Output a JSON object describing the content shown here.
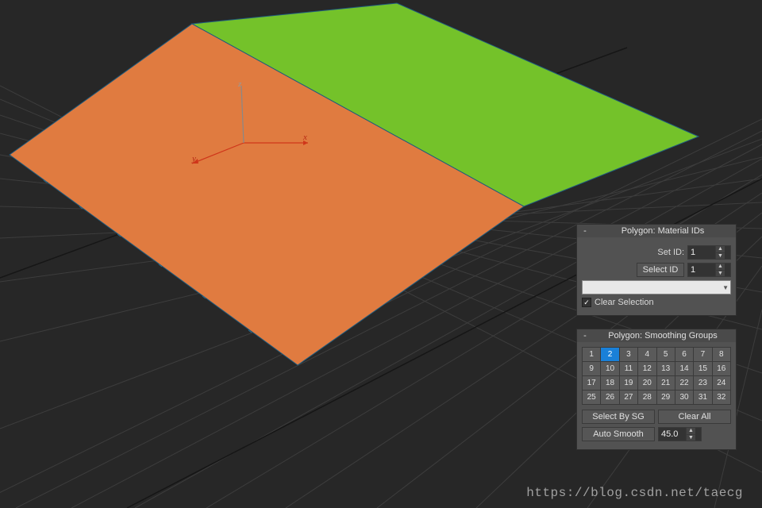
{
  "viewport": {
    "background": "#272727",
    "grid_color": "#3e3e3e",
    "grid_accent": "#555555",
    "plane_color_a": "#e07b40",
    "plane_color_b": "#74c22a",
    "axis_color": "#cf361a",
    "axis_labels": {
      "x": "x",
      "y": "y",
      "z": "z"
    }
  },
  "panel_material": {
    "title": "Polygon: Material IDs",
    "collapse": "-",
    "set_id_label": "Set ID:",
    "set_id_value": "1",
    "select_id_label": "Select ID",
    "select_id_value": "1",
    "clear_selection_label": "Clear Selection",
    "clear_selection_checked": true,
    "dropdown_value": ""
  },
  "panel_smoothing": {
    "title": "Polygon: Smoothing Groups",
    "collapse": "-",
    "groups": [
      1,
      2,
      3,
      4,
      5,
      6,
      7,
      8,
      9,
      10,
      11,
      12,
      13,
      14,
      15,
      16,
      17,
      18,
      19,
      20,
      21,
      22,
      23,
      24,
      25,
      26,
      27,
      28,
      29,
      30,
      31,
      32
    ],
    "active_group": 2,
    "select_by_sg_label": "Select By SG",
    "clear_all_label": "Clear All",
    "auto_smooth_label": "Auto Smooth",
    "auto_smooth_value": "45.0"
  },
  "watermark": "https://blog.csdn.net/taecg"
}
